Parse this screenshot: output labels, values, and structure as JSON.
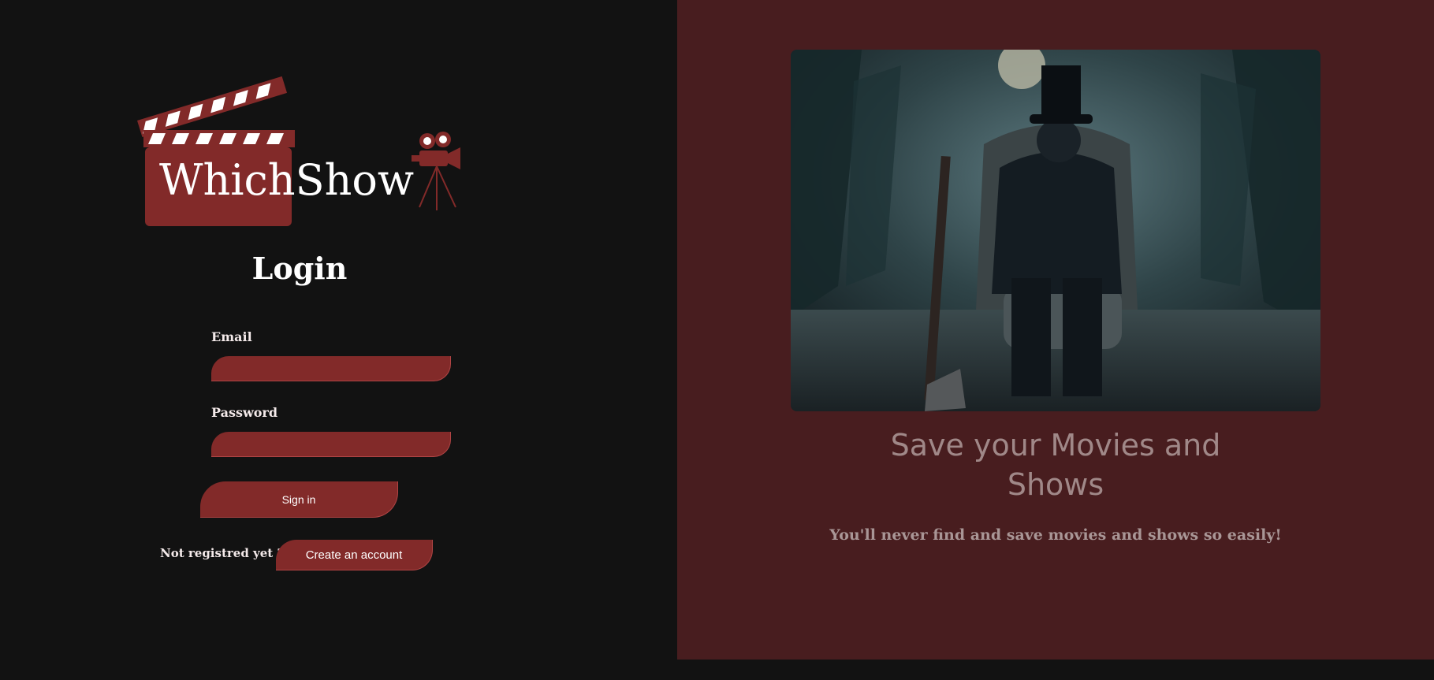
{
  "brand": {
    "name": "WhichShow",
    "accent_color": "#822a29",
    "logo_icon": "clapperboard-icon",
    "projector_icon": "film-projector-icon"
  },
  "login": {
    "title": "Login",
    "email_label": "Email",
    "email_value": "",
    "password_label": "Password",
    "password_value": "",
    "signin_label": "Sign in",
    "not_registered_text": "Not registred yet ?",
    "create_account_label": "Create an account"
  },
  "hero": {
    "image_description_icon": "hero-movie-image",
    "caption": "Save your Movies and Shows",
    "subtitle": "You'll never find and save movies and shows so easily!"
  }
}
